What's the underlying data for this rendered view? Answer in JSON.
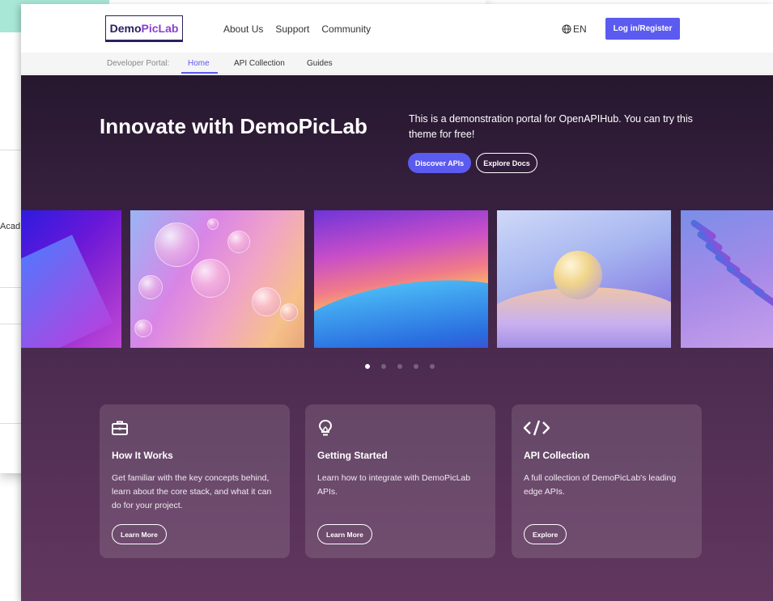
{
  "background_window": {
    "partial_text": "Acad"
  },
  "header": {
    "logo": {
      "part1": "Demo",
      "part2": "PicLab"
    },
    "nav": [
      "About Us",
      "Support",
      "Community"
    ],
    "language": "EN",
    "login_label": "Log in/Register"
  },
  "subnav": {
    "portal_label": "Developer Portal:",
    "tabs": [
      "Home",
      "API Collection",
      "Guides"
    ],
    "active_tab": "Home"
  },
  "hero": {
    "title": "Innovate with DemoPicLab",
    "description": "This is a demonstration portal for OpenAPIHub. You can try this theme for free!",
    "primary_button": "Discover APIs",
    "secondary_button": "Explore Docs"
  },
  "carousel": {
    "slide_count": 5,
    "active_index": 0
  },
  "cards": [
    {
      "icon": "briefcase-icon",
      "title": "How It Works",
      "description": "Get familiar with the key concepts behind, learn about the core stack, and what it can do for your project.",
      "button": "Learn More"
    },
    {
      "icon": "lightbulb-icon",
      "title": "Getting Started",
      "description": "Learn how to integrate with DemoPicLab APIs.",
      "button": "Learn More"
    },
    {
      "icon": "code-icon",
      "title": "API Collection",
      "description": "A full collection of DemoPicLab's leading edge APIs.",
      "button": "Explore"
    }
  ],
  "colors": {
    "accent": "#5b5bf0",
    "logo_dark": "#2a2160",
    "logo_purple": "#8a3fd1",
    "hero_top": "#26172e",
    "hero_bottom": "#62375f"
  }
}
